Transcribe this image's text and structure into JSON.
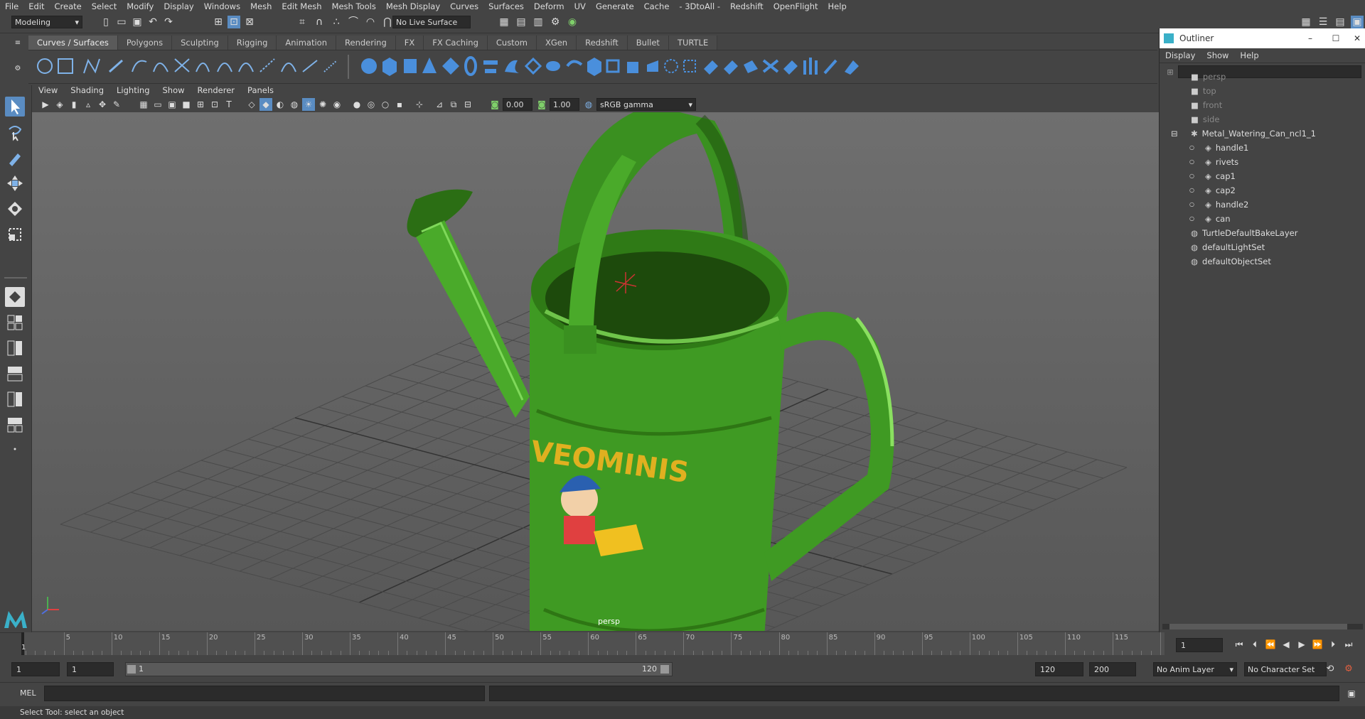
{
  "menubar": [
    "File",
    "Edit",
    "Create",
    "Select",
    "Modify",
    "Display",
    "Windows",
    "Mesh",
    "Edit Mesh",
    "Mesh Tools",
    "Mesh Display",
    "Curves",
    "Surfaces",
    "Deform",
    "UV",
    "Generate",
    "Cache",
    "- 3DtoAll -",
    "Redshift",
    "OpenFlight",
    "Help"
  ],
  "status": {
    "workspace": "Modeling",
    "live_surface": "No Live Surface"
  },
  "shelf_tabs": [
    "Curves / Surfaces",
    "Polygons",
    "Sculpting",
    "Rigging",
    "Animation",
    "Rendering",
    "FX",
    "FX Caching",
    "Custom",
    "XGen",
    "Redshift",
    "Bullet",
    "TURTLE"
  ],
  "viewport": {
    "menus": [
      "View",
      "Shading",
      "Lighting",
      "Show",
      "Renderer",
      "Panels"
    ],
    "exposure": "0.00",
    "gamma": "1.00",
    "color_space": "sRGB gamma",
    "camera_label": "persp",
    "logo_text": "VEOMINIS"
  },
  "outliner": {
    "title": "Outliner",
    "menus": [
      "Display",
      "Show",
      "Help"
    ],
    "cameras": [
      "persp",
      "top",
      "front",
      "side"
    ],
    "group": "Metal_Watering_Can_ncl1_1",
    "children": [
      "handle1",
      "rivets",
      "cap1",
      "cap2",
      "handle2",
      "can"
    ],
    "others": [
      "TurtleDefaultBakeLayer",
      "defaultLightSet",
      "defaultObjectSet"
    ]
  },
  "timeline": {
    "ticks": [
      "5",
      "10",
      "15",
      "20",
      "25",
      "30",
      "35",
      "40",
      "45",
      "50",
      "55",
      "60",
      "65",
      "70",
      "75",
      "80",
      "85",
      "90",
      "95",
      "100",
      "105",
      "110",
      "115"
    ],
    "start_label": "1",
    "current_frame": "1"
  },
  "range": {
    "start": "1",
    "playback_start": "1",
    "slider_start": "1",
    "slider_end": "120",
    "playback_end": "120",
    "end": "200",
    "anim_layer": "No Anim Layer",
    "character_set": "No Character Set"
  },
  "command": {
    "lang": "MEL"
  },
  "help_line": "Select Tool: select an object",
  "colors": {
    "accent": "#5a8cc2",
    "can_green": "#3f9a23"
  }
}
